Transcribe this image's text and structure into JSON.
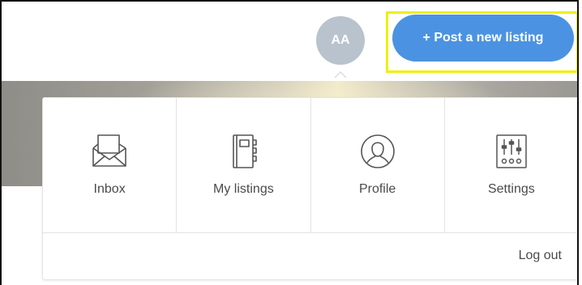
{
  "header": {
    "avatar_initials": "AA",
    "post_button_label": "+ Post a new listing",
    "post_button_color": "#4b93e2",
    "highlight_color": "#eef009"
  },
  "menu": {
    "items": [
      {
        "label": "Inbox",
        "icon": "inbox-icon"
      },
      {
        "label": "My listings",
        "icon": "notebook-icon"
      },
      {
        "label": "Profile",
        "icon": "profile-icon"
      },
      {
        "label": "Settings",
        "icon": "settings-icon"
      }
    ],
    "logout_label": "Log out"
  }
}
